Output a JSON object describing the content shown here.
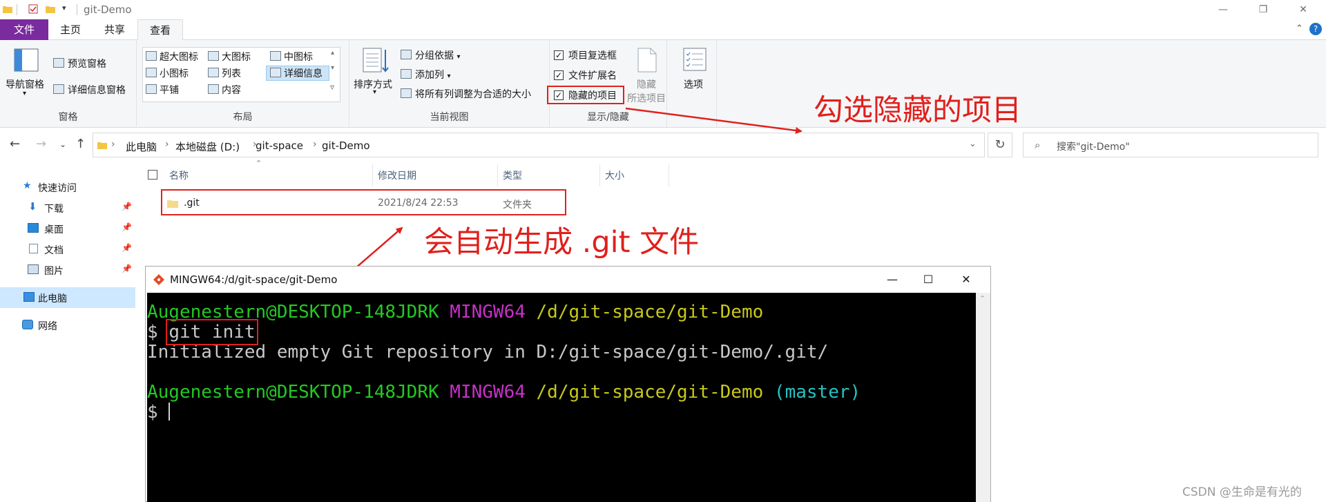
{
  "window": {
    "title": "git-Demo",
    "controls": [
      "—",
      "❐",
      "✕"
    ]
  },
  "ribbon_tabs": [
    {
      "label": "文件",
      "kind": "file"
    },
    {
      "label": "主页",
      "kind": "normal"
    },
    {
      "label": "共享",
      "kind": "normal"
    },
    {
      "label": "查看",
      "kind": "active"
    }
  ],
  "ribbon": {
    "panes": {
      "label": "窗格",
      "nav_pane": "导航窗格",
      "preview_pane": "预览窗格",
      "details_pane": "详细信息窗格"
    },
    "layout": {
      "label": "布局",
      "options": [
        "超大图标",
        "大图标",
        "中图标",
        "小图标",
        "列表",
        "详细信息",
        "平铺",
        "内容"
      ],
      "selected": "详细信息"
    },
    "current_view": {
      "label": "当前视图",
      "sort_by": "排序方式",
      "group_by": "分组依据",
      "add_column": "添加列",
      "fit_columns": "将所有列调整为合适的大小"
    },
    "show_hide": {
      "label": "显示/隐藏",
      "item_checkboxes": "项目复选框",
      "file_extensions": "文件扩展名",
      "hidden_items": "隐藏的项目",
      "hide_selected_1": "隐藏",
      "hide_selected_2": "所选项目"
    },
    "options": "选项"
  },
  "address": {
    "crumbs": [
      "此电脑",
      "本地磁盘 (D:)",
      "git-space",
      "git-Demo"
    ],
    "search_placeholder": "搜索\"git-Demo\""
  },
  "nav_pane": {
    "items": [
      {
        "label": "快速访问",
        "icon": "star-icon",
        "pinned": false
      },
      {
        "label": "下载",
        "icon": "download-icon",
        "pinned": true
      },
      {
        "label": "桌面",
        "icon": "desktop-icon",
        "pinned": true
      },
      {
        "label": "文档",
        "icon": "document-icon",
        "pinned": true
      },
      {
        "label": "图片",
        "icon": "picture-icon",
        "pinned": true
      },
      {
        "label": "此电脑",
        "icon": "computer-icon",
        "pinned": false
      },
      {
        "label": "网络",
        "icon": "network-icon",
        "pinned": false
      }
    ]
  },
  "file_list": {
    "columns": [
      "名称",
      "修改日期",
      "类型",
      "大小"
    ],
    "rows": [
      {
        "name": ".git",
        "modified": "2021/8/24 22:53",
        "type": "文件夹",
        "size": ""
      }
    ]
  },
  "annotations": {
    "hidden_items_note": "勾选隐藏的项目",
    "git_note": "会自动生成 .git 文件"
  },
  "terminal": {
    "title": "MINGW64:/d/git-space/git-Demo",
    "user_host": "Augenestern@DESKTOP-148JDRK",
    "env": "MINGW64",
    "path": "/d/git-space/git-Demo",
    "branch": "(master)",
    "prompt": "$",
    "command": "git init",
    "output": "Initialized empty Git repository in D:/git-space/git-Demo/.git/"
  },
  "watermark": "CSDN @生命是有光的",
  "colors": {
    "file_tab": "#7a2b9e",
    "annotation_red": "#e0201c",
    "term_green": "#24c824",
    "term_magenta": "#c92fc9",
    "term_yellow": "#c8c81e",
    "term_cyan": "#26c3c3"
  }
}
